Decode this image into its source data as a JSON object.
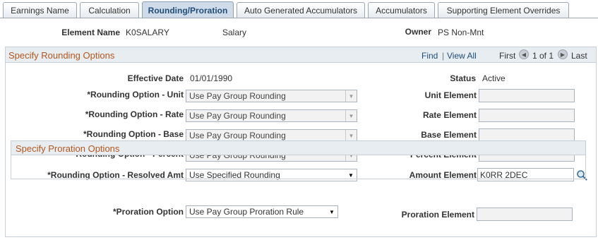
{
  "tabs": [
    {
      "label": "Earnings Name"
    },
    {
      "label": "Calculation"
    },
    {
      "label": "Rounding/Proration"
    },
    {
      "label": "Auto Generated Accumulators"
    },
    {
      "label": "Accumulators"
    },
    {
      "label": "Supporting Element Overrides"
    }
  ],
  "header": {
    "element_name_label": "Element Name",
    "element_name_value": "K0SALARY",
    "element_description": "Salary",
    "owner_label": "Owner",
    "owner_value": "PS Non-Mnt"
  },
  "rounding_group": {
    "title": "Specify Rounding Options",
    "find": "Find",
    "separator": "|",
    "view_all": "View All",
    "first": "First",
    "page_info": "1 of 1",
    "last": "Last",
    "effective_date_label": "Effective Date",
    "effective_date_value": "01/01/1990",
    "status_label": "Status",
    "status_value": "Active",
    "rows": [
      {
        "label": "*Rounding Option - Unit",
        "value": "Use Pay Group Rounding",
        "element_label": "Unit Element",
        "element_value": ""
      },
      {
        "label": "*Rounding Option - Rate",
        "value": "Use Pay Group Rounding",
        "element_label": "Rate Element",
        "element_value": ""
      },
      {
        "label": "*Rounding Option - Base",
        "value": "Use Pay Group Rounding",
        "element_label": "Base Element",
        "element_value": ""
      },
      {
        "label": "*Rounding Option - Percent",
        "value": "Use Pay Group Rounding",
        "element_label": "Percent Element",
        "element_value": ""
      },
      {
        "label": "*Rounding Option - Resolved Amt",
        "value": "Use Specified Rounding",
        "element_label": "Amount Element",
        "element_value": "K0RR 2DEC"
      }
    ]
  },
  "proration_group": {
    "title": "Specify Proration Options",
    "option_label": "*Proration Option",
    "option_value": "Use Pay Group Proration Rule",
    "element_label": "Proration Element",
    "element_value": ""
  },
  "icons": {
    "prev": "chevron-left-icon",
    "next": "chevron-right-icon",
    "dropdown": "chevron-down-icon",
    "lookup": "search-icon"
  },
  "colors": {
    "section_title": "#b5561b",
    "active_tab_bg": "#cfdbe8",
    "link": "#1f4e79"
  }
}
